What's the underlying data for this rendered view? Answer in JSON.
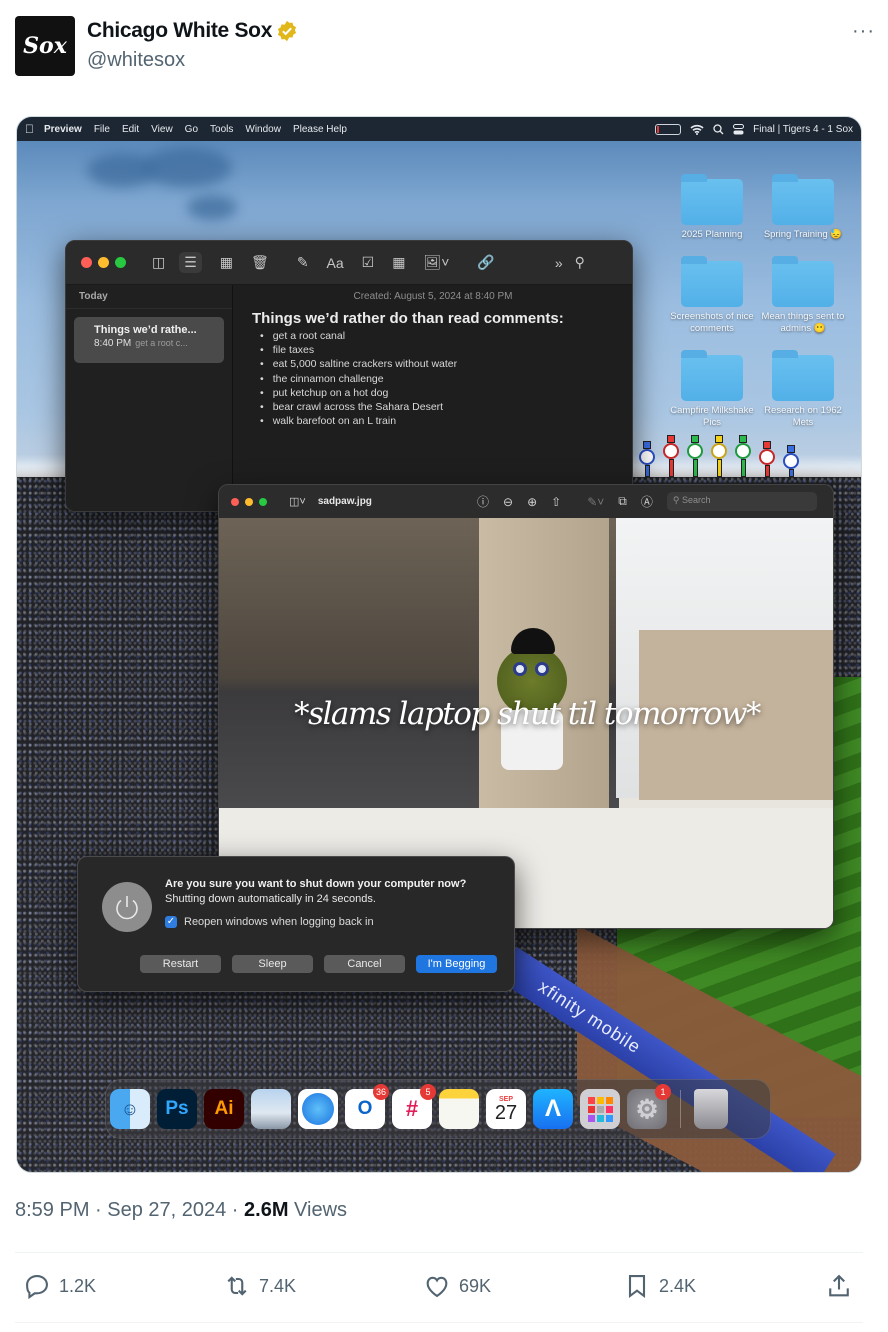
{
  "tweet": {
    "author_name": "Chicago White Sox",
    "handle": "@whitesox",
    "avatar_text": "Sox",
    "verified_color": "#e2b719",
    "more_label": "···",
    "timestamp": "8:59 PM · Sep 27, 2024 · ",
    "views_count": "2.6M",
    "views_label": " Views",
    "actions": {
      "replies": "1.2K",
      "reposts": "7.4K",
      "likes": "69K",
      "bookmarks": "2.4K"
    }
  },
  "desktop": {
    "menubar": {
      "apple": "",
      "app": "Preview",
      "items": [
        "File",
        "Edit",
        "View",
        "Go",
        "Tools",
        "Window",
        "Please Help"
      ],
      "status": "Final | Tigers 4 - 1 Sox"
    },
    "folders": [
      {
        "label": "2025 Planning"
      },
      {
        "label": "Spring Training 😓"
      },
      {
        "label": "Screenshots of nice comments"
      },
      {
        "label": "Mean things sent to admins 😶"
      },
      {
        "label": "Campfire Milkshake Pics"
      },
      {
        "label": "Research on 1962 Mets"
      }
    ],
    "notes": {
      "section": "Today",
      "item_title": "Things we’d rathe...",
      "item_time": "8:40 PM",
      "item_preview": "get a root c...",
      "created": "Created: August 5, 2024 at 8:40 PM",
      "title": "Things we’d rather do than read comments:",
      "list": [
        "get a root canal",
        "file taxes",
        "eat 5,000 saltine crackers without water",
        "the cinnamon challenge",
        "put ketchup on a hot dog",
        "bear crawl across the Sahara Desert",
        "walk barefoot on an L train"
      ],
      "toolbar_font_label": "Aa"
    },
    "preview": {
      "filename": "sadpaw.jpg",
      "search_placeholder": "Search",
      "caption": "*slams laptop shut til tomorrow*"
    },
    "dialog": {
      "question": "Are you sure you want to shut down your computer now?",
      "detail": " Shutting down automatically in 24 seconds.",
      "checkbox_label": "Reopen windows when logging back in",
      "checkbox_checked": true,
      "buttons": [
        "Restart",
        "Sleep",
        "Cancel",
        "I'm Begging"
      ]
    },
    "wall_text": "xfinity mobile",
    "dock": [
      {
        "name": "Finder",
        "badge": null
      },
      {
        "name": "Photoshop",
        "label": "Ps",
        "badge": null
      },
      {
        "name": "Illustrator",
        "label": "Ai",
        "badge": null
      },
      {
        "name": "Preview",
        "badge": null
      },
      {
        "name": "Safari",
        "badge": null
      },
      {
        "name": "Outlook",
        "label": "O",
        "badge": "36"
      },
      {
        "name": "Slack",
        "badge": "5"
      },
      {
        "name": "Notes",
        "badge": null
      },
      {
        "name": "Calendar",
        "month": "SEP",
        "day": "27",
        "badge": null
      },
      {
        "name": "App Store",
        "badge": null
      },
      {
        "name": "Launchpad",
        "badge": null
      },
      {
        "name": "System Settings",
        "badge": "1"
      },
      {
        "name": "Trash",
        "badge": null
      }
    ]
  }
}
